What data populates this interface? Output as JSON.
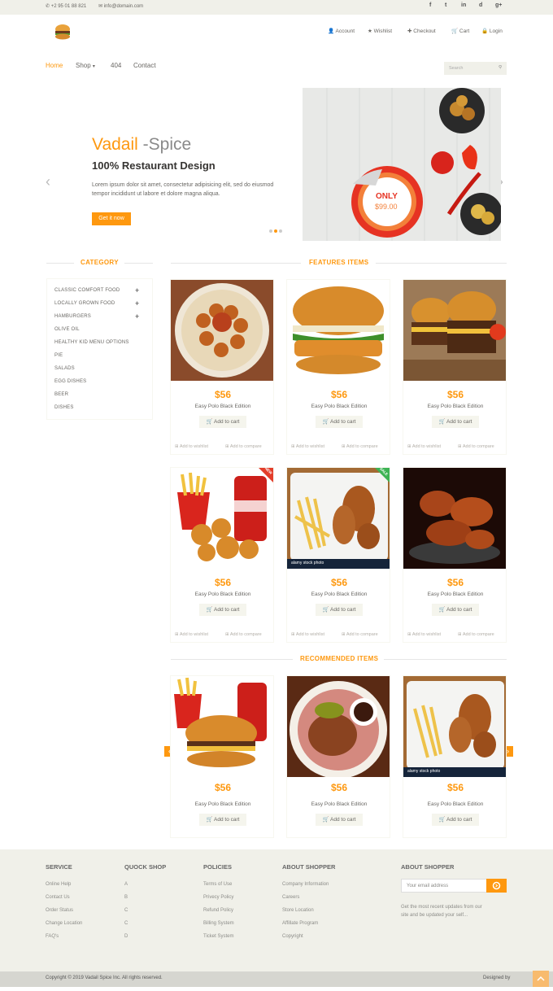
{
  "topbar": {
    "phone": "+2 95 01 88 821",
    "email": "info@domain.com",
    "social": [
      "f",
      "t",
      "in",
      "d",
      "g+"
    ]
  },
  "account_nav": [
    "Account",
    "Wishlist",
    "Checkout",
    "Cart",
    "Login"
  ],
  "main_nav": {
    "home": "Home",
    "shop": "Shop",
    "p404": "404",
    "contact": "Contact"
  },
  "search": {
    "placeholder": "Search"
  },
  "hero": {
    "title_brand": "Vadail",
    "title_rest": " -Spice",
    "subtitle": "100% Restaurant Design",
    "text": "Lorem ipsum dolor sit amet, consectetur adipisicing elit, sed do eiusmod tempor incididunt ut labore et dolore magna aliqua.",
    "cta": "Get it now",
    "badge_top": "ONLY",
    "badge_price": "$99.00"
  },
  "category": {
    "title": "CATEGORY",
    "items": [
      "CLASSIC COMFORT FOOD",
      "LOCALLY GROWN FOOD",
      "HAMBURGERS",
      "OLIVE OIL",
      "HEALTHY KID MENU OPTIONS",
      "PIE",
      "SALADS",
      "EGG DISHES",
      "BEER",
      "DISHES"
    ]
  },
  "features": {
    "title": "FEATURES ITEMS",
    "products": [
      {
        "price": "$56",
        "name": "Easy Polo Black Edition",
        "add": "Add to cart",
        "wishlist": "Add to wishlist",
        "compare": "Add to compare"
      },
      {
        "price": "$56",
        "name": "Easy Polo Black Edition",
        "add": "Add to cart",
        "wishlist": "Add to wishlist",
        "compare": "Add to compare"
      },
      {
        "price": "$56",
        "name": "Easy Polo Black Edition",
        "add": "Add to cart",
        "wishlist": "Add to wishlist",
        "compare": "Add to compare"
      },
      {
        "price": "$56",
        "name": "Easy Polo Black Edition",
        "add": "Add to cart",
        "wishlist": "Add to wishlist",
        "compare": "Add to compare"
      },
      {
        "price": "$56",
        "name": "Easy Polo Black Edition",
        "add": "Add to cart",
        "wishlist": "Add to wishlist",
        "compare": "Add to compare"
      },
      {
        "price": "$56",
        "name": "Easy Polo Black Edition",
        "add": "Add to cart",
        "wishlist": "Add to wishlist",
        "compare": "Add to compare"
      }
    ],
    "badges": {
      "new": "NEW",
      "sale": "SALE"
    },
    "stock_caption": "alamy stock photo"
  },
  "recommended": {
    "title": "RECOMMENDED ITEMS",
    "products": [
      {
        "price": "$56",
        "name": "Easy Polo Black Edition",
        "add": "Add to cart"
      },
      {
        "price": "$56",
        "name": "Easy Polo Black Edition",
        "add": "Add to cart"
      },
      {
        "price": "$56",
        "name": "Easy Polo Black Edition",
        "add": "Add to cart"
      }
    ]
  },
  "footer": {
    "service": {
      "title": "SERVICE",
      "links": [
        "Online Help",
        "Contact Us",
        "Order Status",
        "Change Location",
        "FAQ's"
      ]
    },
    "quick": {
      "title": "QUOCK SHOP",
      "links": [
        "A",
        "B",
        "C",
        "C",
        "D"
      ]
    },
    "policies": {
      "title": "POLICIES",
      "links": [
        "Terms of Use",
        "Privecy Policy",
        "Refund Policy",
        "Billing System",
        "Ticket System"
      ]
    },
    "about": {
      "title": "ABOUT SHOPPER",
      "links": [
        "Company Information",
        "Careers",
        "Store Location",
        "Affillate Program",
        "Copyright"
      ]
    },
    "newsletter": {
      "title": "ABOUT SHOPPER",
      "placeholder": "Your email address",
      "text": "Get the most recent updates from our site and be updated your self..."
    }
  },
  "bottom": {
    "copyright": "Copyright © 2019 Vadail Spice Inc. All rights reserved.",
    "designed": "Designed by"
  },
  "colors": {
    "accent": "#fe980f",
    "bar": "#f0f0e9"
  }
}
